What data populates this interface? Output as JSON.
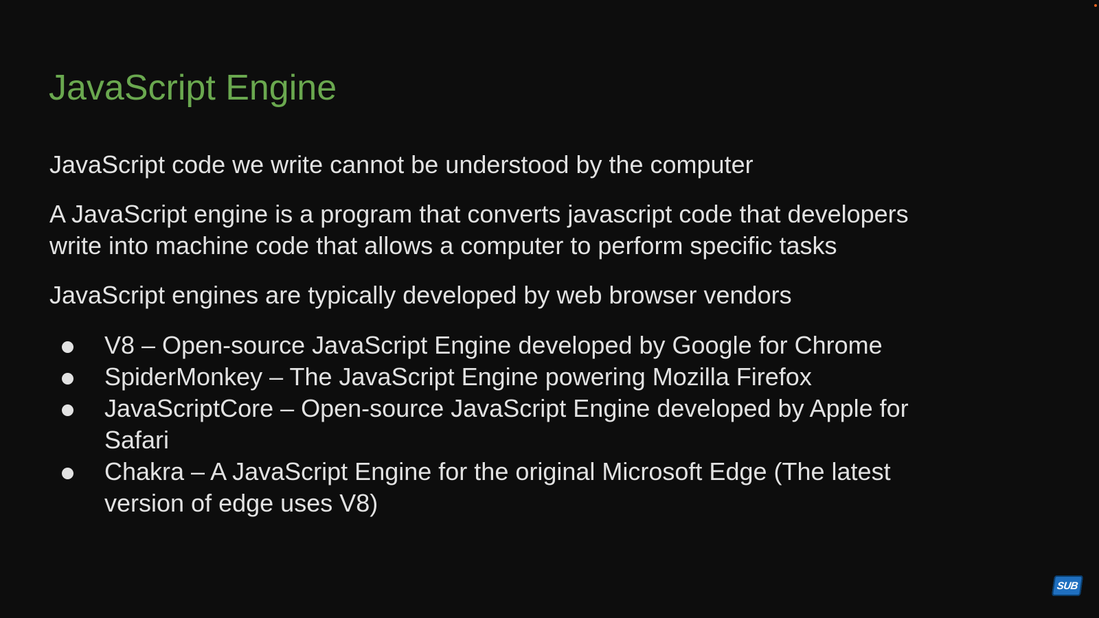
{
  "colors": {
    "title": "#6aa84f",
    "text": "#e2e2e2",
    "background": "#0d0d0d",
    "badge": "#1f6fbf",
    "corner_dot": "#e06020"
  },
  "slide": {
    "title": "JavaScript Engine",
    "paragraphs": [
      {
        "lines": [
          "JavaScript code we write cannot be understood by the computer"
        ]
      },
      {
        "lines": [
          "A JavaScript engine is a program that converts javascript code that developers",
          "write into machine code that allows a computer to perform specific tasks"
        ]
      },
      {
        "lines": [
          "JavaScript engines are typically developed by web browser vendors"
        ]
      }
    ],
    "bullets": [
      {
        "lines": [
          "V8 – Open-source JavaScript Engine developed by Google for Chrome"
        ]
      },
      {
        "lines": [
          "SpiderMonkey – The JavaScript Engine powering Mozilla Firefox"
        ]
      },
      {
        "lines": [
          "JavaScriptCore – Open-source JavaScript Engine developed by Apple for",
          "Safari"
        ]
      },
      {
        "lines": [
          "Chakra – A JavaScript Engine for the original Microsoft Edge (The latest",
          "version of edge uses V8)"
        ]
      }
    ]
  },
  "badge": {
    "label": "SUB"
  }
}
